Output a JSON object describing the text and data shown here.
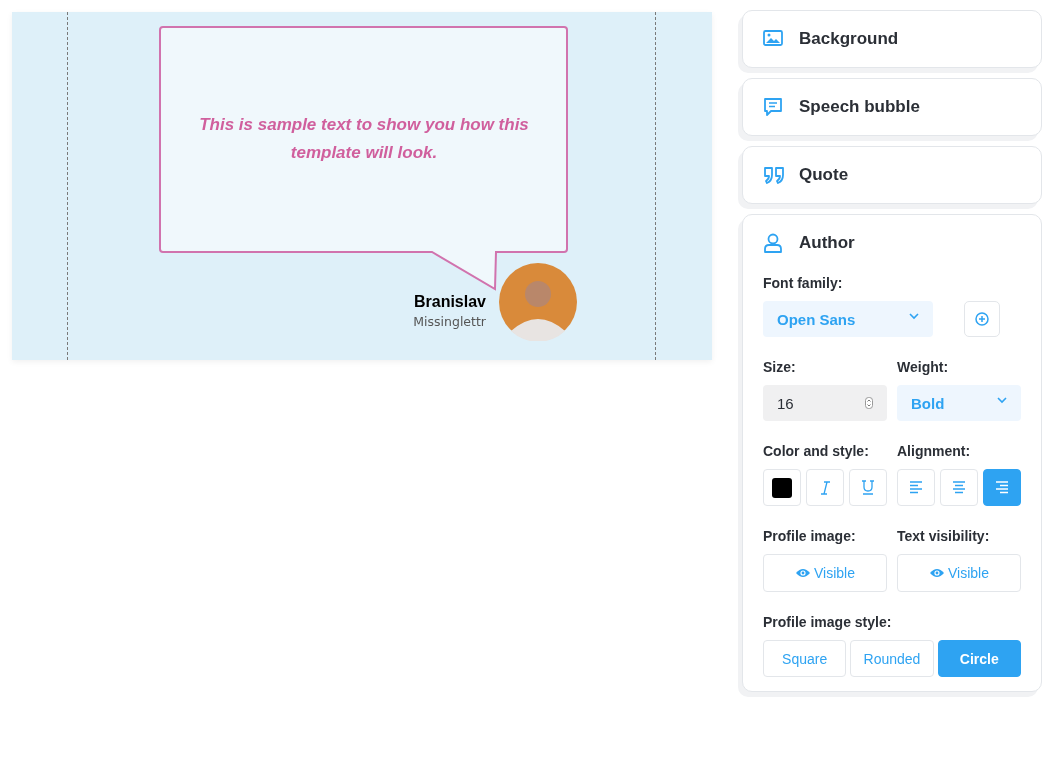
{
  "preview": {
    "quote": "This is sample text to show you how this template will look.",
    "author_name": "Branislav",
    "author_subtitle": "Missinglettr"
  },
  "sections": [
    {
      "kind": "background",
      "title": "Background",
      "expanded": false
    },
    {
      "kind": "bubble",
      "title": "Speech bubble",
      "expanded": false
    },
    {
      "kind": "quote",
      "title": "Quote",
      "expanded": false
    },
    {
      "kind": "author",
      "title": "Author",
      "expanded": true
    }
  ],
  "author_settings": {
    "font_family": {
      "label": "Font family:",
      "value": "Open Sans"
    },
    "size": {
      "label": "Size:",
      "value": "16"
    },
    "weight": {
      "label": "Weight:",
      "value": "Bold"
    },
    "color_style": {
      "label": "Color and style:",
      "color": "#000000",
      "italic": false,
      "underline": false
    },
    "alignment": {
      "label": "Alignment:",
      "options": [
        {
          "kind": "left",
          "selected": false
        },
        {
          "kind": "center",
          "selected": false
        },
        {
          "kind": "right",
          "selected": true
        }
      ]
    },
    "profile_image": {
      "label": "Profile image:",
      "value": "Visible"
    },
    "text_visibility": {
      "label": "Text visibility:",
      "value": "Visible"
    },
    "profile_image_style": {
      "label": "Profile image style:",
      "options": [
        {
          "label": "Square",
          "selected": false
        },
        {
          "label": "Rounded",
          "selected": false
        },
        {
          "label": "Circle",
          "selected": true
        }
      ]
    }
  }
}
